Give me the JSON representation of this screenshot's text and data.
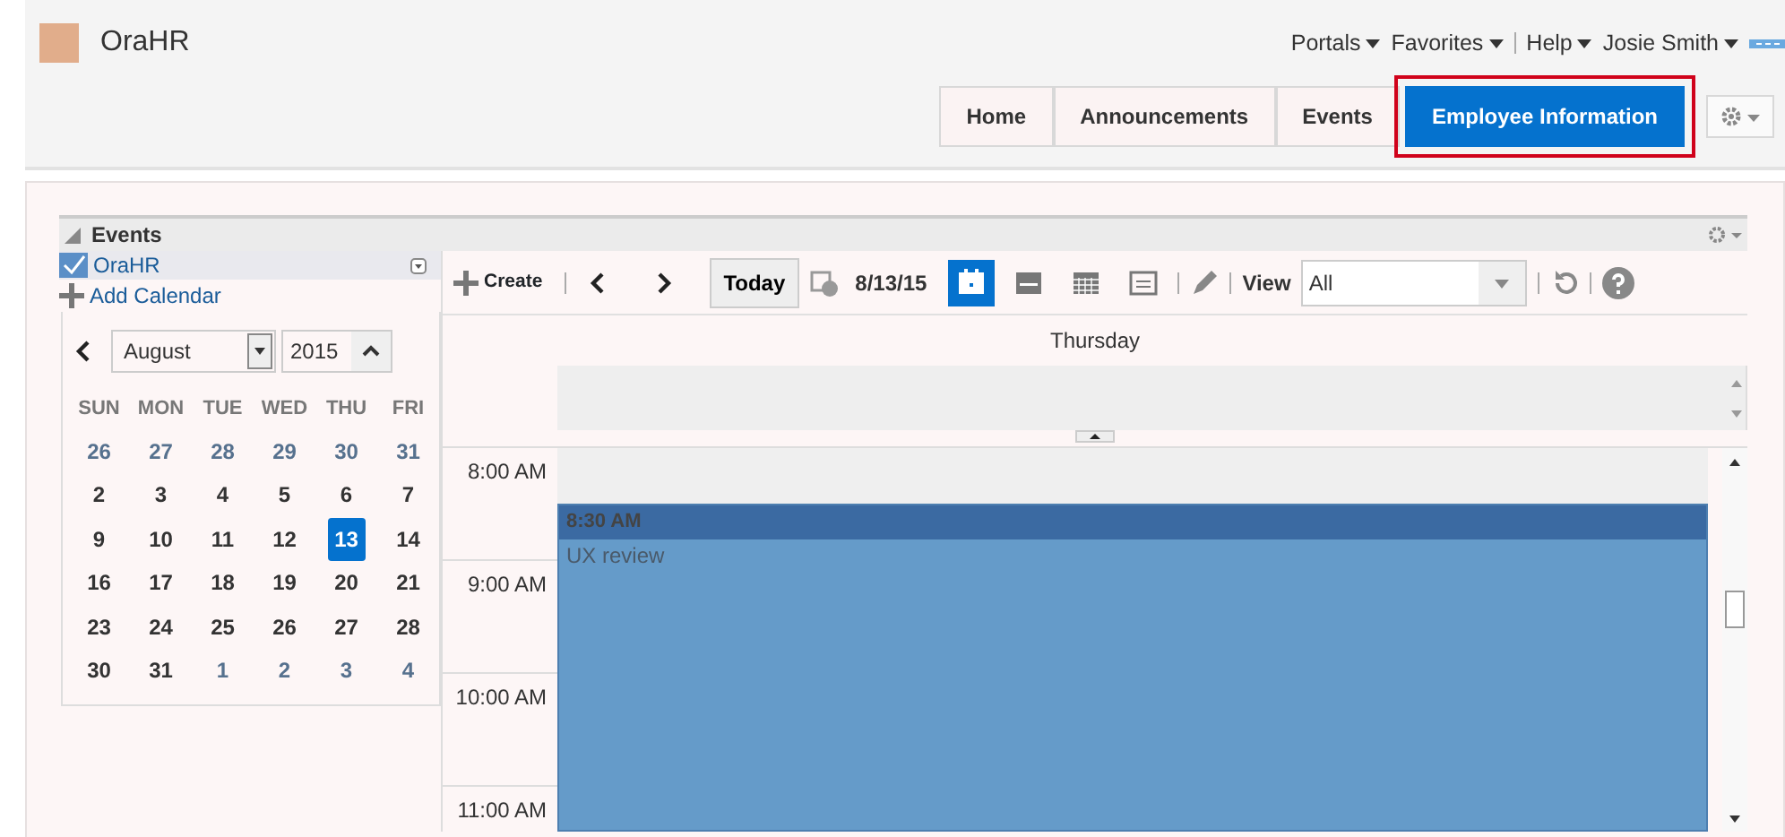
{
  "app": {
    "title": "OraHR"
  },
  "global_menu": [
    {
      "label": "Portals",
      "has_menu": true
    },
    {
      "label": "Favorites",
      "has_menu": true
    },
    {
      "label": "Help",
      "has_menu": true
    },
    {
      "label": "Josie Smith",
      "has_menu": true
    }
  ],
  "tabs": [
    {
      "label": "Home",
      "selected": false,
      "outlined": false
    },
    {
      "label": "Announcements",
      "selected": false,
      "outlined": false
    },
    {
      "label": "Events",
      "selected": false,
      "outlined": false
    },
    {
      "label": "Employee Information",
      "selected": true,
      "outlined": true
    }
  ],
  "panel": {
    "title": "Events",
    "calendars": [
      {
        "name": "OraHR",
        "checked": true
      }
    ],
    "add_calendar": "Add Calendar",
    "mini_calendar": {
      "month": "August",
      "year": "2015",
      "weekdays": [
        "SUN",
        "MON",
        "TUE",
        "WED",
        "THU",
        "FRI"
      ],
      "weeks": [
        [
          {
            "day": "26",
            "in_month": false,
            "selected": false
          },
          {
            "day": "27",
            "in_month": false,
            "selected": false
          },
          {
            "day": "28",
            "in_month": false,
            "selected": false
          },
          {
            "day": "29",
            "in_month": false,
            "selected": false
          },
          {
            "day": "30",
            "in_month": false,
            "selected": false
          },
          {
            "day": "31",
            "in_month": false,
            "selected": false
          }
        ],
        [
          {
            "day": "2",
            "in_month": true,
            "selected": false
          },
          {
            "day": "3",
            "in_month": true,
            "selected": false
          },
          {
            "day": "4",
            "in_month": true,
            "selected": false
          },
          {
            "day": "5",
            "in_month": true,
            "selected": false
          },
          {
            "day": "6",
            "in_month": true,
            "selected": false
          },
          {
            "day": "7",
            "in_month": true,
            "selected": false
          }
        ],
        [
          {
            "day": "9",
            "in_month": true,
            "selected": false
          },
          {
            "day": "10",
            "in_month": true,
            "selected": false
          },
          {
            "day": "11",
            "in_month": true,
            "selected": false
          },
          {
            "day": "12",
            "in_month": true,
            "selected": false
          },
          {
            "day": "13",
            "in_month": true,
            "selected": true
          },
          {
            "day": "14",
            "in_month": true,
            "selected": false
          }
        ],
        [
          {
            "day": "16",
            "in_month": true,
            "selected": false
          },
          {
            "day": "17",
            "in_month": true,
            "selected": false
          },
          {
            "day": "18",
            "in_month": true,
            "selected": false
          },
          {
            "day": "19",
            "in_month": true,
            "selected": false
          },
          {
            "day": "20",
            "in_month": true,
            "selected": false
          },
          {
            "day": "21",
            "in_month": true,
            "selected": false
          }
        ],
        [
          {
            "day": "23",
            "in_month": true,
            "selected": false
          },
          {
            "day": "24",
            "in_month": true,
            "selected": false
          },
          {
            "day": "25",
            "in_month": true,
            "selected": false
          },
          {
            "day": "26",
            "in_month": true,
            "selected": false
          },
          {
            "day": "27",
            "in_month": true,
            "selected": false
          },
          {
            "day": "28",
            "in_month": true,
            "selected": false
          }
        ],
        [
          {
            "day": "30",
            "in_month": true,
            "selected": false
          },
          {
            "day": "31",
            "in_month": true,
            "selected": false
          },
          {
            "day": "1",
            "in_month": false,
            "selected": false
          },
          {
            "day": "2",
            "in_month": false,
            "selected": false
          },
          {
            "day": "3",
            "in_month": false,
            "selected": false
          },
          {
            "day": "4",
            "in_month": false,
            "selected": false
          }
        ]
      ]
    }
  },
  "toolbar": {
    "create": "Create",
    "today": "Today",
    "date": "8/13/15",
    "view_modes": [
      {
        "kind": "day",
        "selected": true
      },
      {
        "kind": "week",
        "selected": false
      },
      {
        "kind": "month",
        "selected": false
      },
      {
        "kind": "list",
        "selected": false
      }
    ],
    "view_label": "View",
    "view_value": "All"
  },
  "day_header": "Thursday",
  "hours": [
    "8:00 AM",
    "9:00 AM",
    "10:00 AM",
    "11:00 AM"
  ],
  "events": [
    {
      "time": "8:30 AM",
      "title": "UX review"
    }
  ]
}
